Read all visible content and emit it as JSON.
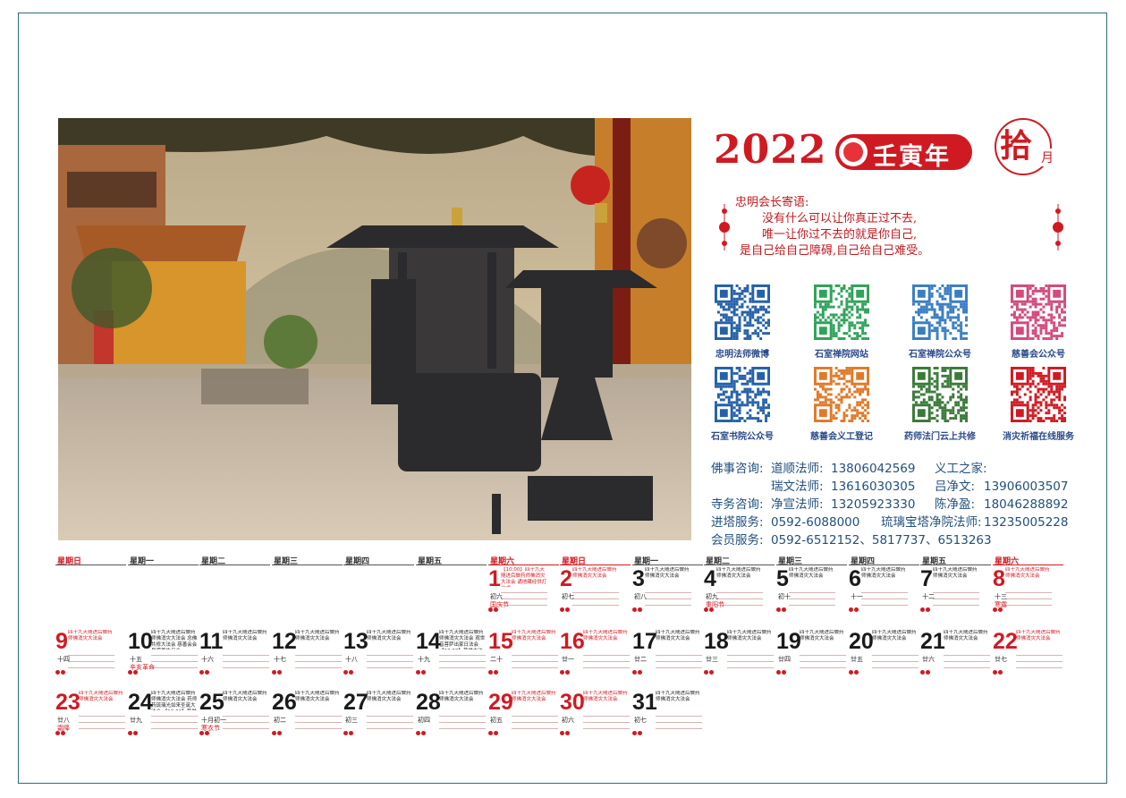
{
  "header": {
    "year": "2022",
    "year_name": "壬寅年",
    "month_big": "拾",
    "month_small": "月"
  },
  "message": {
    "title": "忠明会长寄语:",
    "lines": [
      "没有什么可以让你真正过不去,",
      "唯一让你过不去的就是你自己,",
      "是自己给自己障碍,自己给自己难受。"
    ]
  },
  "qrcodes": [
    {
      "label": "忠明法师微博",
      "color": "#2561a8"
    },
    {
      "label": "石室禅院网站",
      "color": "#2fa35a"
    },
    {
      "label": "石室禅院公众号",
      "color": "#3a7ec2"
    },
    {
      "label": "慈善会公众号",
      "color": "#d34a7c"
    },
    {
      "label": "石室书院公众号",
      "color": "#2561a8"
    },
    {
      "label": "慈善会义工登记",
      "color": "#e07a2a"
    },
    {
      "label": "药师法门云上共修",
      "color": "#3a7a3a"
    },
    {
      "label": "消灾祈福在线服务",
      "color": "#d01a22"
    }
  ],
  "contacts": [
    [
      "佛事咨询:",
      "道顺法师:",
      "13806042569",
      "义工之家:",
      ""
    ],
    [
      "",
      "瑞文法师:",
      "13616030305",
      "吕净文:",
      "13906003507"
    ],
    [
      "寺务咨询:",
      "净宣法师:",
      "13205923330",
      "陈净盈:",
      "18046288892"
    ],
    [
      "进塔服务:",
      "0592-6088000",
      "",
      "琉璃宝塔净院法师:",
      "13235005228"
    ],
    [
      "会员服务:",
      "0592-6512152、5817737、6513263",
      "",
      "",
      ""
    ]
  ],
  "calendar": {
    "weekday_headers": [
      "星期日",
      "星期一",
      "星期二",
      "星期三",
      "星期四",
      "星期五",
      "星期六",
      "星期日",
      "星期一",
      "星期二",
      "星期三",
      "星期四",
      "星期五",
      "星期六"
    ],
    "days": [
      {
        "n": "1",
        "lunar": "初六",
        "fest": "国庆节",
        "ev": "【10:00】四十九天随进后做药师佛消灾大法会 诵地藏经供灯仪式",
        "red": true
      },
      {
        "n": "2",
        "lunar": "初七",
        "fest": "",
        "ev": "四十九天随进后做药师佛消灾大法会",
        "red": true
      },
      {
        "n": "3",
        "lunar": "初八",
        "fest": "",
        "ev": "四十九天随进后做药师佛消灾大法会",
        "red": false
      },
      {
        "n": "4",
        "lunar": "初九",
        "fest": "重阳节",
        "ev": "四十九天随进后做药师佛消灾大法会",
        "red": false
      },
      {
        "n": "5",
        "lunar": "初十",
        "fest": "",
        "ev": "四十九天随进后做药师佛消灾大法会",
        "red": false
      },
      {
        "n": "6",
        "lunar": "十一",
        "fest": "",
        "ev": "四十九天随进后做药师佛消灾大法会",
        "red": false
      },
      {
        "n": "7",
        "lunar": "十二",
        "fest": "",
        "ev": "四十九天随进后做药师佛消灾大法会",
        "red": false
      },
      {
        "n": "8",
        "lunar": "十三",
        "fest": "寒露",
        "ev": "四十九天随进后做药师佛消灾大法会",
        "red": true
      },
      {
        "n": "9",
        "lunar": "十四",
        "fest": "",
        "ev": "四十九天随进后做药师佛消灾大法会",
        "red": true
      },
      {
        "n": "10",
        "lunar": "十五",
        "fest": "辛亥革命",
        "ev": "四十九天随进后做药师佛消灾大法会 念佛共修大法会 慈善会会员感恩生日会",
        "red": false
      },
      {
        "n": "11",
        "lunar": "十六",
        "fest": "",
        "ev": "四十九天随进后做药师佛消灾大法会",
        "red": false
      },
      {
        "n": "12",
        "lunar": "十七",
        "fest": "",
        "ev": "四十九天随进后做药师佛消灾大法会",
        "red": false
      },
      {
        "n": "13",
        "lunar": "十八",
        "fest": "",
        "ev": "四十九天随进后做药师佛消灾大法会",
        "red": false
      },
      {
        "n": "14",
        "lunar": "十九",
        "fest": "",
        "ev": "四十九天随进后做药师佛消灾大法会 观世音菩萨出家日法会 【13:00】普供大法会",
        "red": false
      },
      {
        "n": "15",
        "lunar": "二十",
        "fest": "",
        "ev": "四十九天随进后做药师佛消灾大法会",
        "red": true
      },
      {
        "n": "16",
        "lunar": "廿一",
        "fest": "",
        "ev": "四十九天随进后做药师佛消灾大法会",
        "red": true
      },
      {
        "n": "17",
        "lunar": "廿二",
        "fest": "",
        "ev": "四十九天随进后做药师佛消灾大法会",
        "red": false
      },
      {
        "n": "18",
        "lunar": "廿三",
        "fest": "",
        "ev": "四十九天随进后做药师佛消灾大法会",
        "red": false
      },
      {
        "n": "19",
        "lunar": "廿四",
        "fest": "",
        "ev": "四十九天随进后做药师佛消灾大法会",
        "red": false
      },
      {
        "n": "20",
        "lunar": "廿五",
        "fest": "",
        "ev": "四十九天随进后做药师佛消灾大法会",
        "red": false
      },
      {
        "n": "21",
        "lunar": "廿六",
        "fest": "",
        "ev": "四十九天随进后做药师佛消灾大法会",
        "red": false
      },
      {
        "n": "22",
        "lunar": "廿七",
        "fest": "",
        "ev": "四十九天随进后做药师佛消灾大法会",
        "red": true
      },
      {
        "n": "23",
        "lunar": "廿八",
        "fest": "霜降",
        "ev": "四十九天随进后做药师佛消灾大法会",
        "red": true
      },
      {
        "n": "24",
        "lunar": "廿九",
        "fest": "",
        "ev": "四十九天随进后做药师佛消灾大法会 药师药琉璃光如来圣诞大法会 【10:00】普供大法会",
        "red": false
      },
      {
        "n": "25",
        "lunar": "十月初一",
        "fest": "寒衣节",
        "ev": "四十九天随进后做药师佛消灾大法会",
        "red": false
      },
      {
        "n": "26",
        "lunar": "初二",
        "fest": "",
        "ev": "四十九天随进后做药师佛消灾大法会",
        "red": false
      },
      {
        "n": "27",
        "lunar": "初三",
        "fest": "",
        "ev": "四十九天随进后做药师佛消灾大法会",
        "red": false
      },
      {
        "n": "28",
        "lunar": "初四",
        "fest": "",
        "ev": "四十九天随进后做药师佛消灾大法会",
        "red": false
      },
      {
        "n": "29",
        "lunar": "初五",
        "fest": "",
        "ev": "四十九天随进后做药师佛消灾大法会",
        "red": true
      },
      {
        "n": "30",
        "lunar": "初六",
        "fest": "",
        "ev": "四十九天随进后做药师佛消灾大法会",
        "red": true
      },
      {
        "n": "31",
        "lunar": "初七",
        "fest": "",
        "ev": "四十九天随进后做药师佛消灾大法会",
        "red": false
      }
    ]
  }
}
